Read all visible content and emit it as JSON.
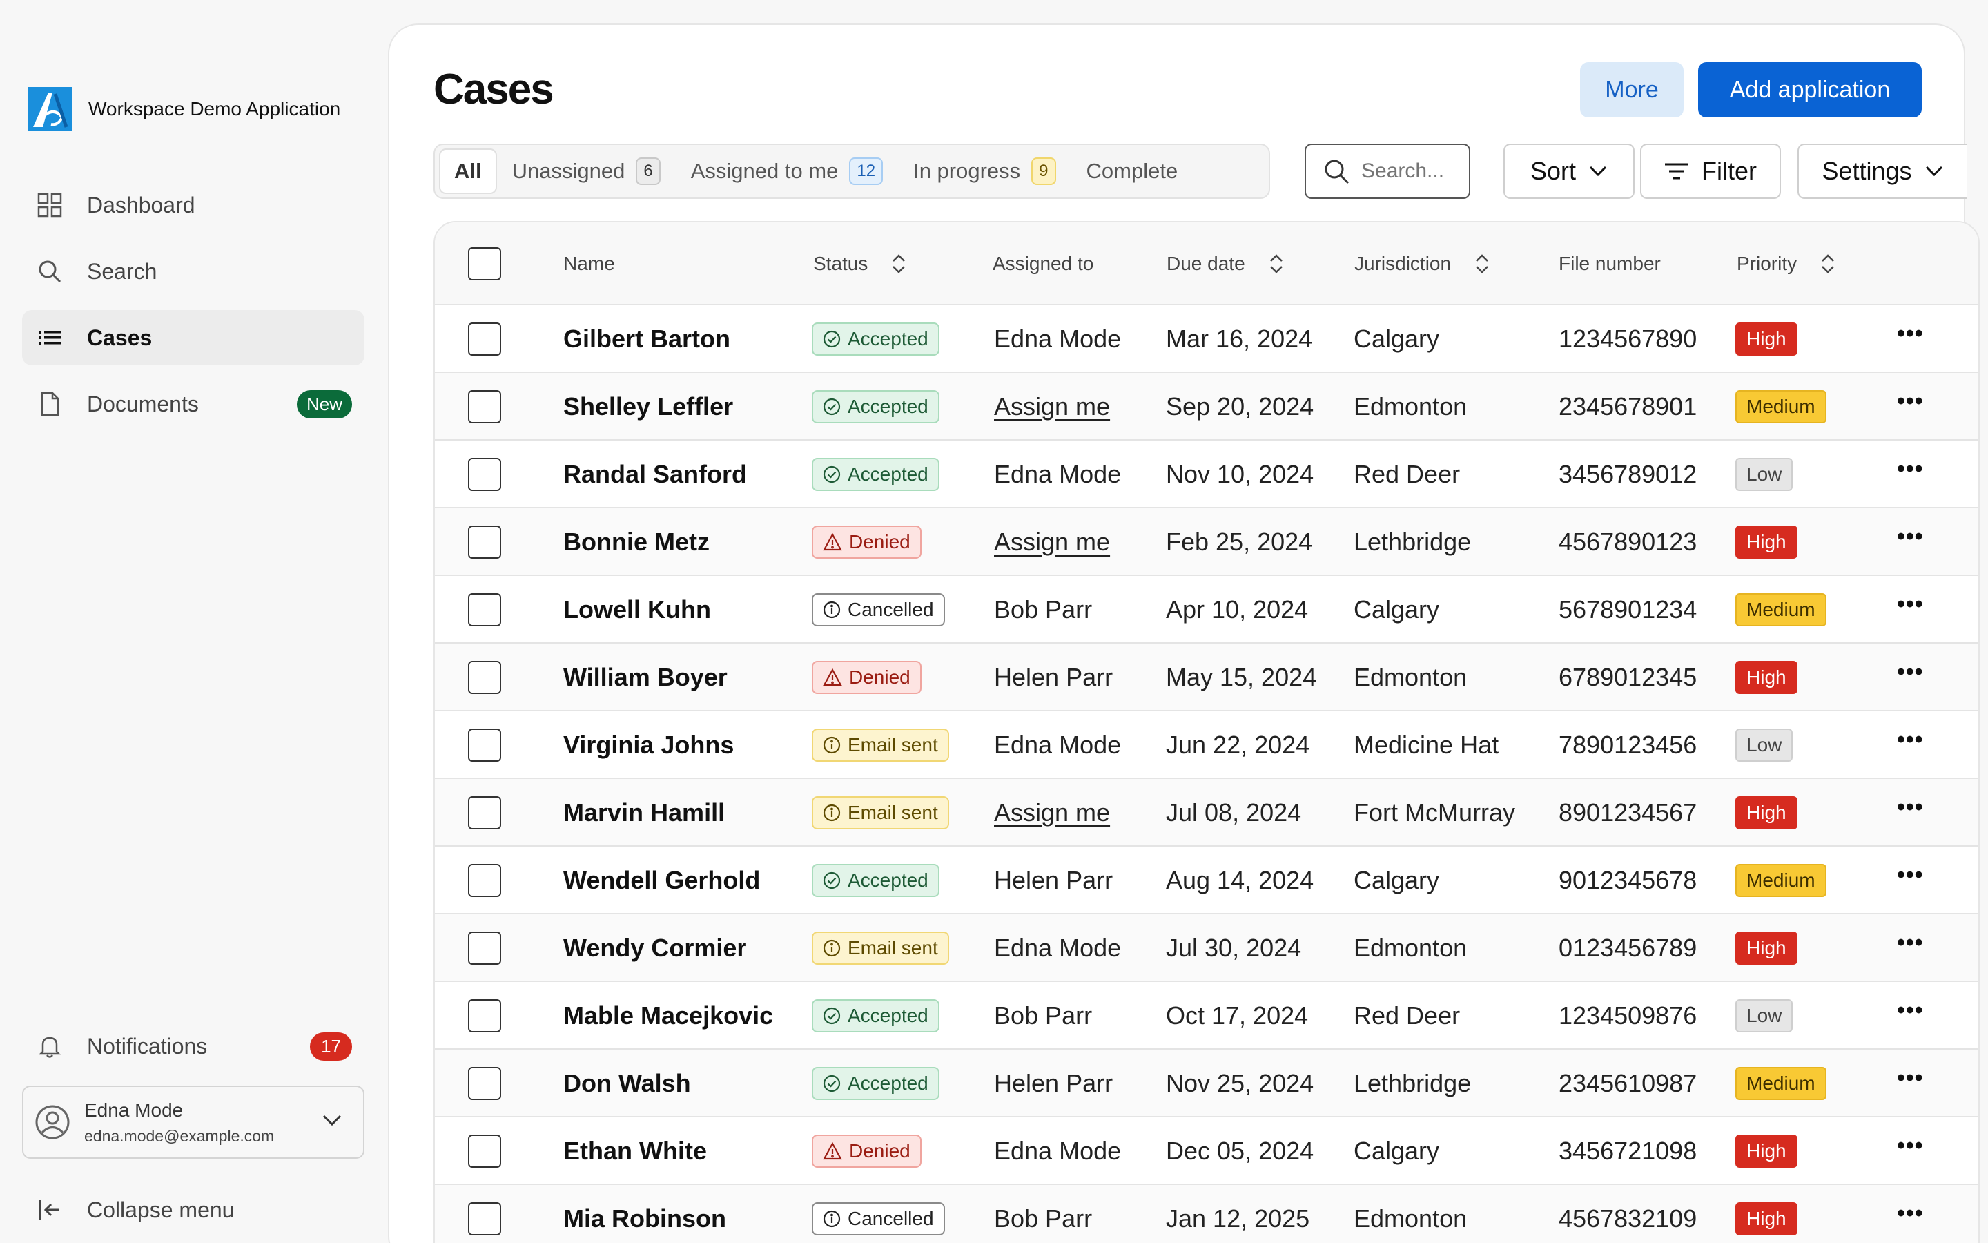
{
  "app": {
    "name": "Workspace Demo Application"
  },
  "sidebar": {
    "items": [
      {
        "label": "Dashboard",
        "icon": "dashboard-icon"
      },
      {
        "label": "Search",
        "icon": "search-icon"
      },
      {
        "label": "Cases",
        "icon": "list-icon",
        "active": true
      },
      {
        "label": "Documents",
        "icon": "document-icon",
        "badge": "New"
      }
    ],
    "notifications": {
      "label": "Notifications",
      "count": "17"
    },
    "user": {
      "name": "Edna Mode",
      "email": "edna.mode@example.com"
    },
    "collapse_label": "Collapse menu"
  },
  "header": {
    "title": "Cases",
    "more_label": "More",
    "add_label": "Add application"
  },
  "tabs": [
    {
      "label": "All"
    },
    {
      "label": "Unassigned",
      "count": "6"
    },
    {
      "label": "Assigned to me",
      "count": "12"
    },
    {
      "label": "In progress",
      "count": "9"
    },
    {
      "label": "Complete"
    }
  ],
  "toolbar": {
    "search_placeholder": "Search...",
    "sort_label": "Sort",
    "filter_label": "Filter",
    "settings_label": "Settings"
  },
  "table": {
    "columns": {
      "name": "Name",
      "status": "Status",
      "assigned": "Assigned to",
      "due": "Due date",
      "jurisdiction": "Jurisdiction",
      "file": "File number",
      "priority": "Priority"
    },
    "rows": [
      {
        "name": "Gilbert Barton",
        "status": "Accepted",
        "assigned": "Edna Mode",
        "due": "Mar 16, 2024",
        "jurisdiction": "Calgary",
        "file": "1234567890",
        "priority": "High"
      },
      {
        "name": "Shelley Leffler",
        "status": "Accepted",
        "assigned": "Assign me",
        "due": "Sep 20, 2024",
        "jurisdiction": "Edmonton",
        "file": "2345678901",
        "priority": "Medium"
      },
      {
        "name": "Randal Sanford",
        "status": "Accepted",
        "assigned": "Edna Mode",
        "due": "Nov 10, 2024",
        "jurisdiction": "Red Deer",
        "file": "3456789012",
        "priority": "Low"
      },
      {
        "name": "Bonnie Metz",
        "status": "Denied",
        "assigned": "Assign me",
        "due": "Feb 25, 2024",
        "jurisdiction": "Lethbridge",
        "file": "4567890123",
        "priority": "High"
      },
      {
        "name": "Lowell Kuhn",
        "status": "Cancelled",
        "assigned": "Bob Parr",
        "due": "Apr 10, 2024",
        "jurisdiction": "Calgary",
        "file": "5678901234",
        "priority": "Medium"
      },
      {
        "name": "William Boyer",
        "status": "Denied",
        "assigned": "Helen Parr",
        "due": "May 15, 2024",
        "jurisdiction": "Edmonton",
        "file": "6789012345",
        "priority": "High"
      },
      {
        "name": "Virginia Johns",
        "status": "Email sent",
        "assigned": "Edna Mode",
        "due": "Jun 22, 2024",
        "jurisdiction": "Medicine Hat",
        "file": "7890123456",
        "priority": "Low"
      },
      {
        "name": "Marvin Hamill",
        "status": "Email sent",
        "assigned": "Assign me",
        "due": "Jul 08, 2024",
        "jurisdiction": "Fort McMurray",
        "file": "8901234567",
        "priority": "High"
      },
      {
        "name": "Wendell Gerhold",
        "status": "Accepted",
        "assigned": "Helen Parr",
        "due": "Aug 14, 2024",
        "jurisdiction": "Calgary",
        "file": "9012345678",
        "priority": "Medium"
      },
      {
        "name": "Wendy Cormier",
        "status": "Email sent",
        "assigned": "Edna Mode",
        "due": "Jul 30, 2024",
        "jurisdiction": "Edmonton",
        "file": "0123456789",
        "priority": "High"
      },
      {
        "name": "Mable Macejkovic",
        "status": "Accepted",
        "assigned": "Bob Parr",
        "due": "Oct 17, 2024",
        "jurisdiction": "Red Deer",
        "file": "1234509876",
        "priority": "Low"
      },
      {
        "name": "Don Walsh",
        "status": "Accepted",
        "assigned": "Helen Parr",
        "due": "Nov 25, 2024",
        "jurisdiction": "Lethbridge",
        "file": "2345610987",
        "priority": "Medium"
      },
      {
        "name": "Ethan White",
        "status": "Denied",
        "assigned": "Edna Mode",
        "due": "Dec 05, 2024",
        "jurisdiction": "Calgary",
        "file": "3456721098",
        "priority": "High"
      },
      {
        "name": "Mia Robinson",
        "status": "Cancelled",
        "assigned": "Bob Parr",
        "due": "Jan 12, 2025",
        "jurisdiction": "Edmonton",
        "file": "4567832109",
        "priority": "High"
      }
    ]
  },
  "colors": {
    "accent": "#0a63d4",
    "new_badge": "#0b6b3a",
    "high": "#d62b1f",
    "medium": "#f8c934"
  }
}
